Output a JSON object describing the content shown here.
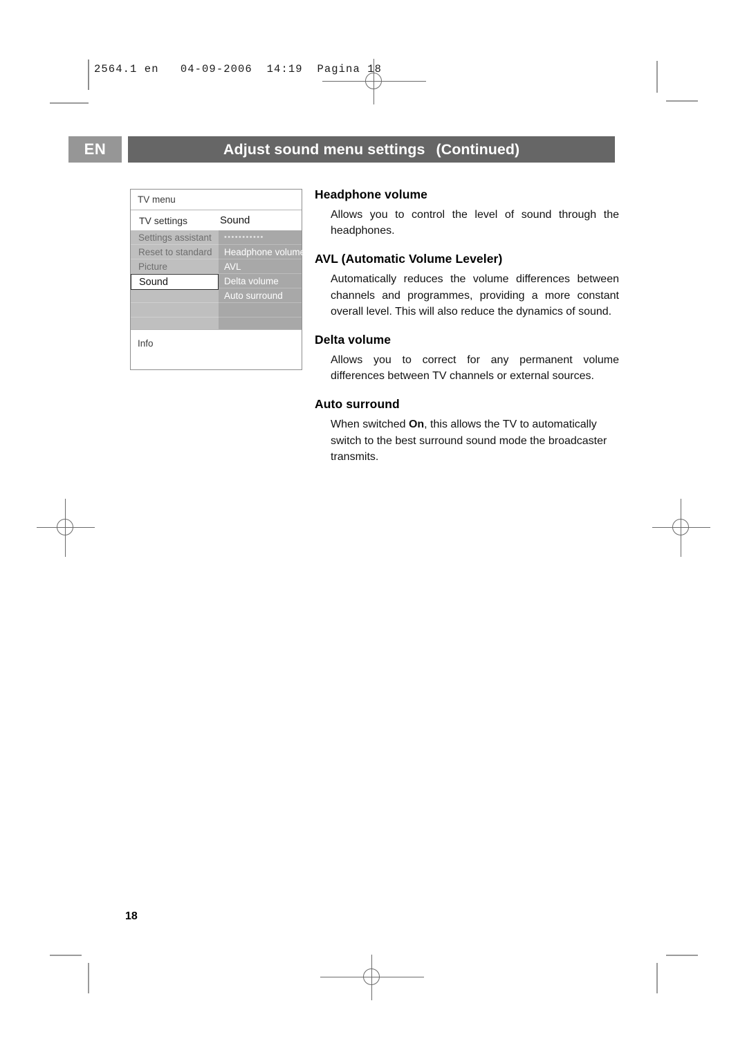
{
  "print_marks": {
    "slug_line": "2564.1 en   04-09-2006  14:19  Pagina 18"
  },
  "header": {
    "language_code": "EN",
    "title": "Adjust sound menu settings",
    "title_suffix": "(Continued)"
  },
  "tv_menu": {
    "title": "TV menu",
    "subhead_left": "TV settings",
    "subhead_right": "Sound",
    "left_column": [
      "Settings assistant",
      "Reset to standard",
      "Picture",
      "",
      "",
      ""
    ],
    "selected_item": "Sound",
    "right_column": [
      "•••••••••••",
      "Headphone volume",
      "AVL",
      "Delta volume",
      "Auto surround",
      ""
    ],
    "info_label": "Info"
  },
  "article": {
    "sections": [
      {
        "heading": "Headphone volume",
        "body": "Allows you to control the level of sound through the headphones."
      },
      {
        "heading": "AVL (Automatic Volume Leveler)",
        "body": "Automatically reduces the volume differences between channels and programmes, providing a more constant overall level. This will also reduce the dynamics of sound."
      },
      {
        "heading": "Delta volume",
        "body": "Allows you to correct for any permanent volume differences between TV channels or external sources."
      },
      {
        "heading": "Auto surround",
        "body_before": "When switched ",
        "body_bold": "On",
        "body_after": ", this allows the TV to automatically switch to the best surround sound mode the broadcaster transmits."
      }
    ]
  },
  "footer": {
    "page_number": "18"
  },
  "colors": {
    "title_bar": "#666666",
    "lang_box": "#969696",
    "menu_left_col": "#bfbfbf",
    "menu_right_col": "#a8a8a8"
  }
}
